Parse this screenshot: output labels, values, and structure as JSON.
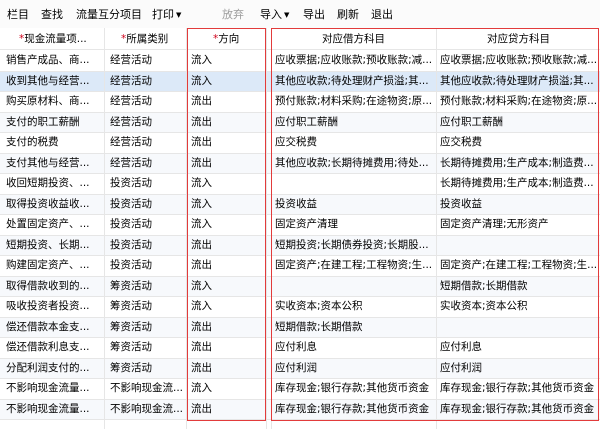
{
  "toolbar": {
    "items": [
      {
        "label": "栏目",
        "dropdown": false,
        "disabled": false
      },
      {
        "label": "查找",
        "dropdown": false,
        "disabled": false
      },
      {
        "label": "流量互分项目",
        "dropdown": false,
        "disabled": false
      },
      {
        "label": "打印",
        "dropdown": true,
        "disabled": false
      },
      {
        "label": "放弃",
        "dropdown": false,
        "disabled": true
      },
      {
        "label": "导入",
        "dropdown": true,
        "disabled": false
      },
      {
        "label": "导出",
        "dropdown": false,
        "disabled": false
      },
      {
        "label": "刷新",
        "dropdown": false,
        "disabled": false
      },
      {
        "label": "退出",
        "dropdown": false,
        "disabled": false
      }
    ]
  },
  "table": {
    "columns": [
      {
        "label": "现金流量项...",
        "required": true
      },
      {
        "label": "所属类别",
        "required": true
      },
      {
        "label": "方向",
        "required": true
      },
      {
        "label": "对应借方科目",
        "required": false
      },
      {
        "label": "对应贷方科目",
        "required": false
      }
    ],
    "rows": [
      [
        "销售产成品、商...",
        "经营活动",
        "流入",
        "应收票据;应收账款;预收账款;减...",
        "应收票据;应收账款;预收账款;减..."
      ],
      [
        "收到其他与经营...",
        "经营活动",
        "流入",
        "其他应收款;待处理财产损溢;其...",
        "其他应收款;待处理财产损溢;其..."
      ],
      [
        "购买原材料、商...",
        "经营活动",
        "流出",
        "预付账款;材料采购;在途物资;原...",
        "预付账款;材料采购;在途物资;原..."
      ],
      [
        "支付的职工薪酬",
        "经营活动",
        "流出",
        "应付职工薪酬",
        "应付职工薪酬"
      ],
      [
        "支付的税费",
        "经营活动",
        "流出",
        "应交税费",
        "应交税费"
      ],
      [
        "支付其他与经营...",
        "经营活动",
        "流出",
        "其他应收款;长期待摊费用;待处...",
        "长期待摊费用;生产成本;制造费..."
      ],
      [
        "收回短期投资、...",
        "投资活动",
        "流入",
        "",
        "长期待摊费用;生产成本;制造费..."
      ],
      [
        "取得投资收益收...",
        "投资活动",
        "流入",
        "投资收益",
        "投资收益"
      ],
      [
        "处置固定资产、...",
        "投资活动",
        "流入",
        "固定资产清理",
        "固定资产清理;无形资产"
      ],
      [
        "短期投资、长期...",
        "投资活动",
        "流出",
        "短期投资;长期债券投资;长期股...",
        ""
      ],
      [
        "购建固定资产、...",
        "投资活动",
        "流出",
        "固定资产;在建工程;工程物资;生...",
        "固定资产;在建工程;工程物资;生..."
      ],
      [
        "取得借款收到的...",
        "筹资活动",
        "流入",
        "",
        "短期借款;长期借款"
      ],
      [
        "吸收投资者投资...",
        "筹资活动",
        "流入",
        "实收资本;资本公积",
        "实收资本;资本公积"
      ],
      [
        "偿还借款本金支...",
        "筹资活动",
        "流出",
        "短期借款;长期借款",
        ""
      ],
      [
        "偿还借款利息支...",
        "筹资活动",
        "流出",
        "应付利息",
        "应付利息"
      ],
      [
        "分配利润支付的...",
        "筹资活动",
        "流出",
        "应付利润",
        "应付利润"
      ],
      [
        "不影响现金流量...",
        "不影响现金流...",
        "流入",
        "库存现金;银行存款;其他货币资金",
        "库存现金;银行存款;其他货币资金"
      ],
      [
        "不影响现金流量...",
        "不影响现金流...",
        "流出",
        "库存现金;银行存款;其他货币资金",
        "库存现金;银行存款;其他货币资金"
      ]
    ],
    "selected_row": 1
  },
  "colors": {
    "highlight_box": "#e23b3b",
    "required_mark": "#d0021b",
    "selected_row": "#dce9f8"
  }
}
